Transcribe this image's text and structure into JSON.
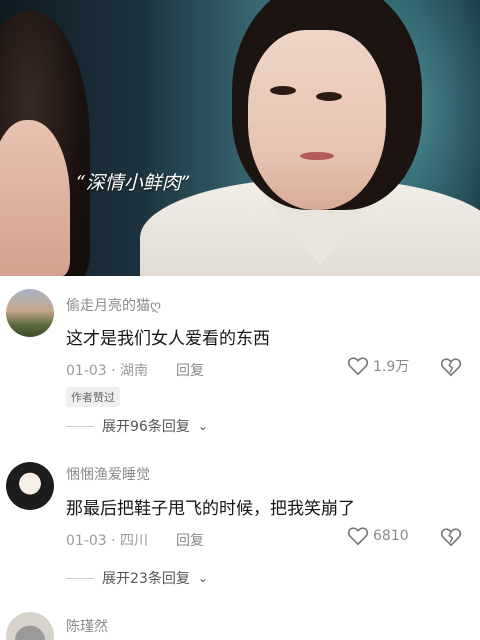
{
  "video": {
    "caption": "“深情小鲜肉”"
  },
  "comments": [
    {
      "username": "偷走月亮的猫ღ",
      "text": "这才是我们女人爱看的东西",
      "date_location": "01-03 · 湖南",
      "reply_label": "回复",
      "likes": "1.9万",
      "badge": "作者赞过",
      "expand_label": "展开96条回复"
    },
    {
      "username": "悃悃渔爱睡觉",
      "text": "那最后把鞋子甩飞的时候，把我笑崩了",
      "date_location": "01-03 · 四川",
      "reply_label": "回复",
      "likes": "6810",
      "expand_label": "展开23条回复"
    },
    {
      "username": "陈瑾然"
    }
  ],
  "icons": {
    "like": "heart-outline-icon",
    "dislike": "broken-heart-icon",
    "expand": "chevron-down-icon"
  },
  "colors": {
    "username": "#8a8a8a",
    "text": "#161616",
    "meta": "#9b9b9b"
  }
}
